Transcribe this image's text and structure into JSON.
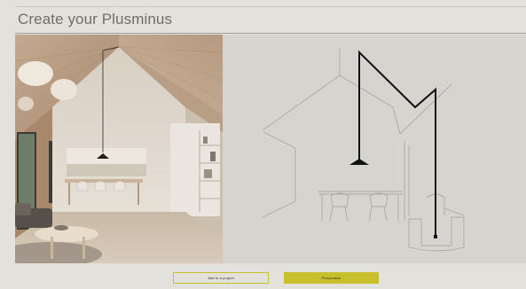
{
  "page": {
    "title": "Create your Plusminus"
  },
  "gallery": {
    "photo_alt": "Interior scene with Plusminus lamp",
    "illustration_alt": "Line sketch of Plusminus configuration"
  },
  "actions": {
    "add_to_project_label": "Add to a project",
    "personalize_label": "Personalize"
  },
  "colors": {
    "accent": "#c7c02c",
    "background": "#e3e1dc",
    "sketch_background": "#d6d4cf",
    "title_text": "#6f6e6a"
  }
}
